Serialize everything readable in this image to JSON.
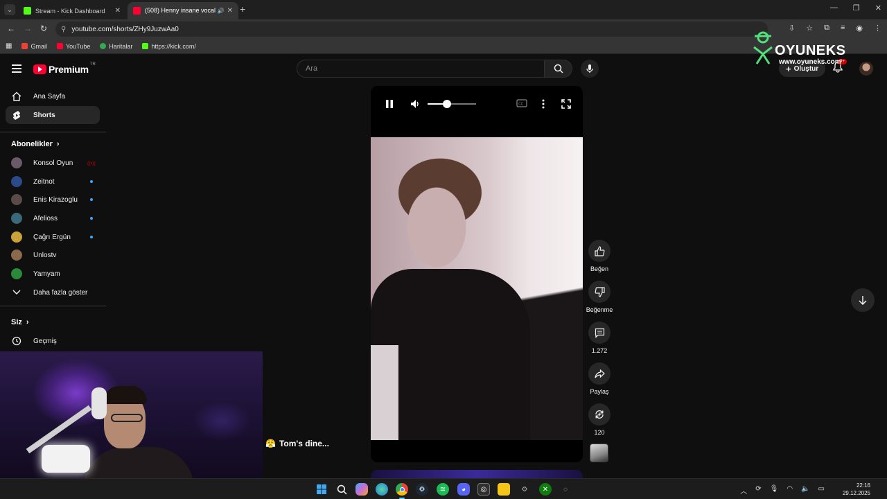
{
  "browser": {
    "tabs": [
      {
        "title": "Stream - Kick Dashboard",
        "active": false,
        "favicon_color": "#53fc18"
      },
      {
        "title": "(508) Henny insane vocal 🔥",
        "active": true,
        "favicon_color": "#ff0033"
      }
    ],
    "url_site_icon": "site-info-icon",
    "url": "youtube.com/shorts/ZHy9JuzwAa0",
    "bookmarks": [
      {
        "label": "Gmail",
        "icon_color": "#ea4335"
      },
      {
        "label": "YouTube",
        "icon_color": "#ff0033"
      },
      {
        "label": "Haritalar",
        "icon_color": "#34a853"
      },
      {
        "label": "https://kick.com/",
        "icon_color": "#53fc18"
      }
    ]
  },
  "youtube": {
    "brand": "Premium",
    "country": "TR",
    "search_placeholder": "Ara",
    "create_label": "Oluştur",
    "notification_count": "9+"
  },
  "watermark": {
    "name": "OYUNEKS",
    "site": "www.oyuneks.com"
  },
  "sidebar": {
    "main": [
      {
        "label": "Ana Sayfa",
        "icon": "home-icon"
      },
      {
        "label": "Shorts",
        "icon": "shorts-icon",
        "active": true
      }
    ],
    "subscriptions_title": "Abonelikler",
    "channels": [
      {
        "label": "Konsol Oyun",
        "status": "live",
        "avatar_color": "#6a5a6a"
      },
      {
        "label": "Zeitnot",
        "status": "new",
        "avatar_color": "#2a4a8a"
      },
      {
        "label": "Enis Kirazoglu",
        "status": "new",
        "avatar_color": "#5a4a4a"
      },
      {
        "label": "Afelioss",
        "status": "new",
        "avatar_color": "#3a6a7a"
      },
      {
        "label": "Çağrı Ergün",
        "status": "new",
        "avatar_color": "#c9a23a"
      },
      {
        "label": "Unlostv",
        "status": "none",
        "avatar_color": "#8a6a4a"
      },
      {
        "label": "Yamyam",
        "status": "none",
        "avatar_color": "#2a8a3a"
      }
    ],
    "show_more": "Daha fazla göster",
    "you_title": "Siz",
    "history": "Geçmiş"
  },
  "player": {
    "state": "playing",
    "volume_percent": 40
  },
  "actions": {
    "like": "Beğen",
    "dislike": "Beğenme",
    "comments": "1.272",
    "share": "Paylaş",
    "remix": "120"
  },
  "caption": {
    "emoji": "😤",
    "text": "Tom's dine..."
  },
  "taskbar": {
    "time": "22:16",
    "date": "29.12.2025",
    "apps": [
      "windows-start-icon",
      "search-icon",
      "copilot-icon",
      "edge-icon",
      "chrome-icon",
      "steam-icon",
      "spotify-icon",
      "discord-icon",
      "obs-icon",
      "file-explorer-icon",
      "settings-icon",
      "xbox-icon",
      "extra-app-icon"
    ]
  }
}
